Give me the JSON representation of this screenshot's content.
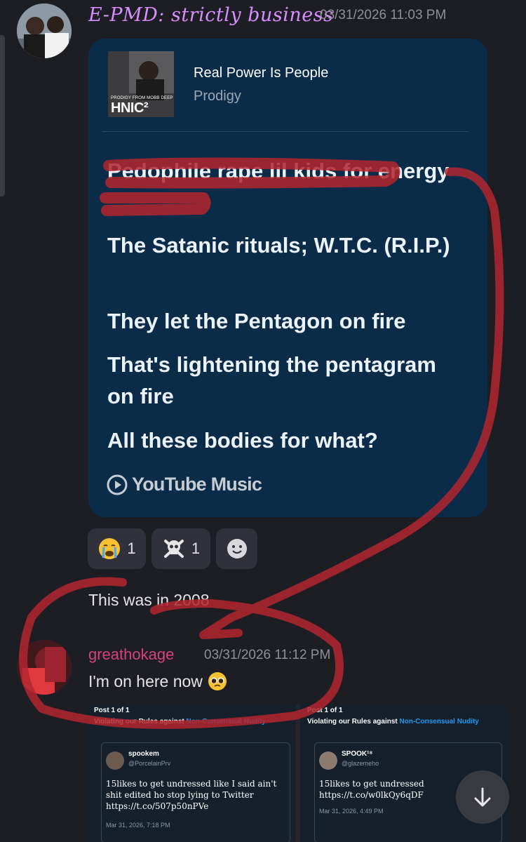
{
  "message1": {
    "author": "E-PMD: strictly business",
    "timestamp": "03/31/2026 11:03 PM",
    "embed": {
      "cover_small_text": "PRODIGY FROM MOBB DEEP",
      "cover_big_text": "HNIC²",
      "song_title": "Real Power Is People",
      "artist": "Prodigy",
      "lyrics": [
        "Pedophile rape lil kids for energy",
        "The Satanic rituals; W.T.C. (R.I.P.)",
        "They let the Pentagon on fire",
        "That's lightening the pentagram on fire",
        "All these bodies for what?"
      ],
      "source": "YouTube Music"
    },
    "reactions": [
      {
        "emoji": "crying-face",
        "count": "1"
      },
      {
        "emoji": "skull-crossbones",
        "count": "1"
      },
      {
        "emoji": "add-reaction"
      }
    ],
    "followup": "This was in 2008"
  },
  "message2": {
    "author": "greathokage",
    "timestamp": "03/31/2026 11:12 PM",
    "text": "I'm on here now",
    "emoji": "pleading-face",
    "attachments": [
      {
        "post_label": "Post 1 of 1",
        "violation_prefix": "Violating our Rules against ",
        "violation_link": "Non-Consensual Nudity",
        "tweet_name": "spookem",
        "tweet_handle": "@PorcelainPrv",
        "tweet_text": "15likes to get undressed like I said ain't shit edited ho stop lying to Twitter https://t.co/507p50nPVe",
        "tweet_date": "Mar 31, 2026, 7:18 PM"
      },
      {
        "post_label": "Post 1 of 1",
        "violation_prefix": "Violating our Rules against ",
        "violation_link": "Non-Consensual Nudity",
        "tweet_name": "SPOOK¹⁸",
        "tweet_handle": "@glazemeho",
        "tweet_text": "15likes to get undressed https://t.co/w0lkQy6qDF",
        "tweet_date": "Mar 31, 2026, 4:49 PM"
      }
    ]
  },
  "colors": {
    "background": "#1d1e23",
    "card": "#0b2c49",
    "author1": "#d88dff",
    "author2": "#d4427c",
    "annotation": "#b3262f"
  }
}
